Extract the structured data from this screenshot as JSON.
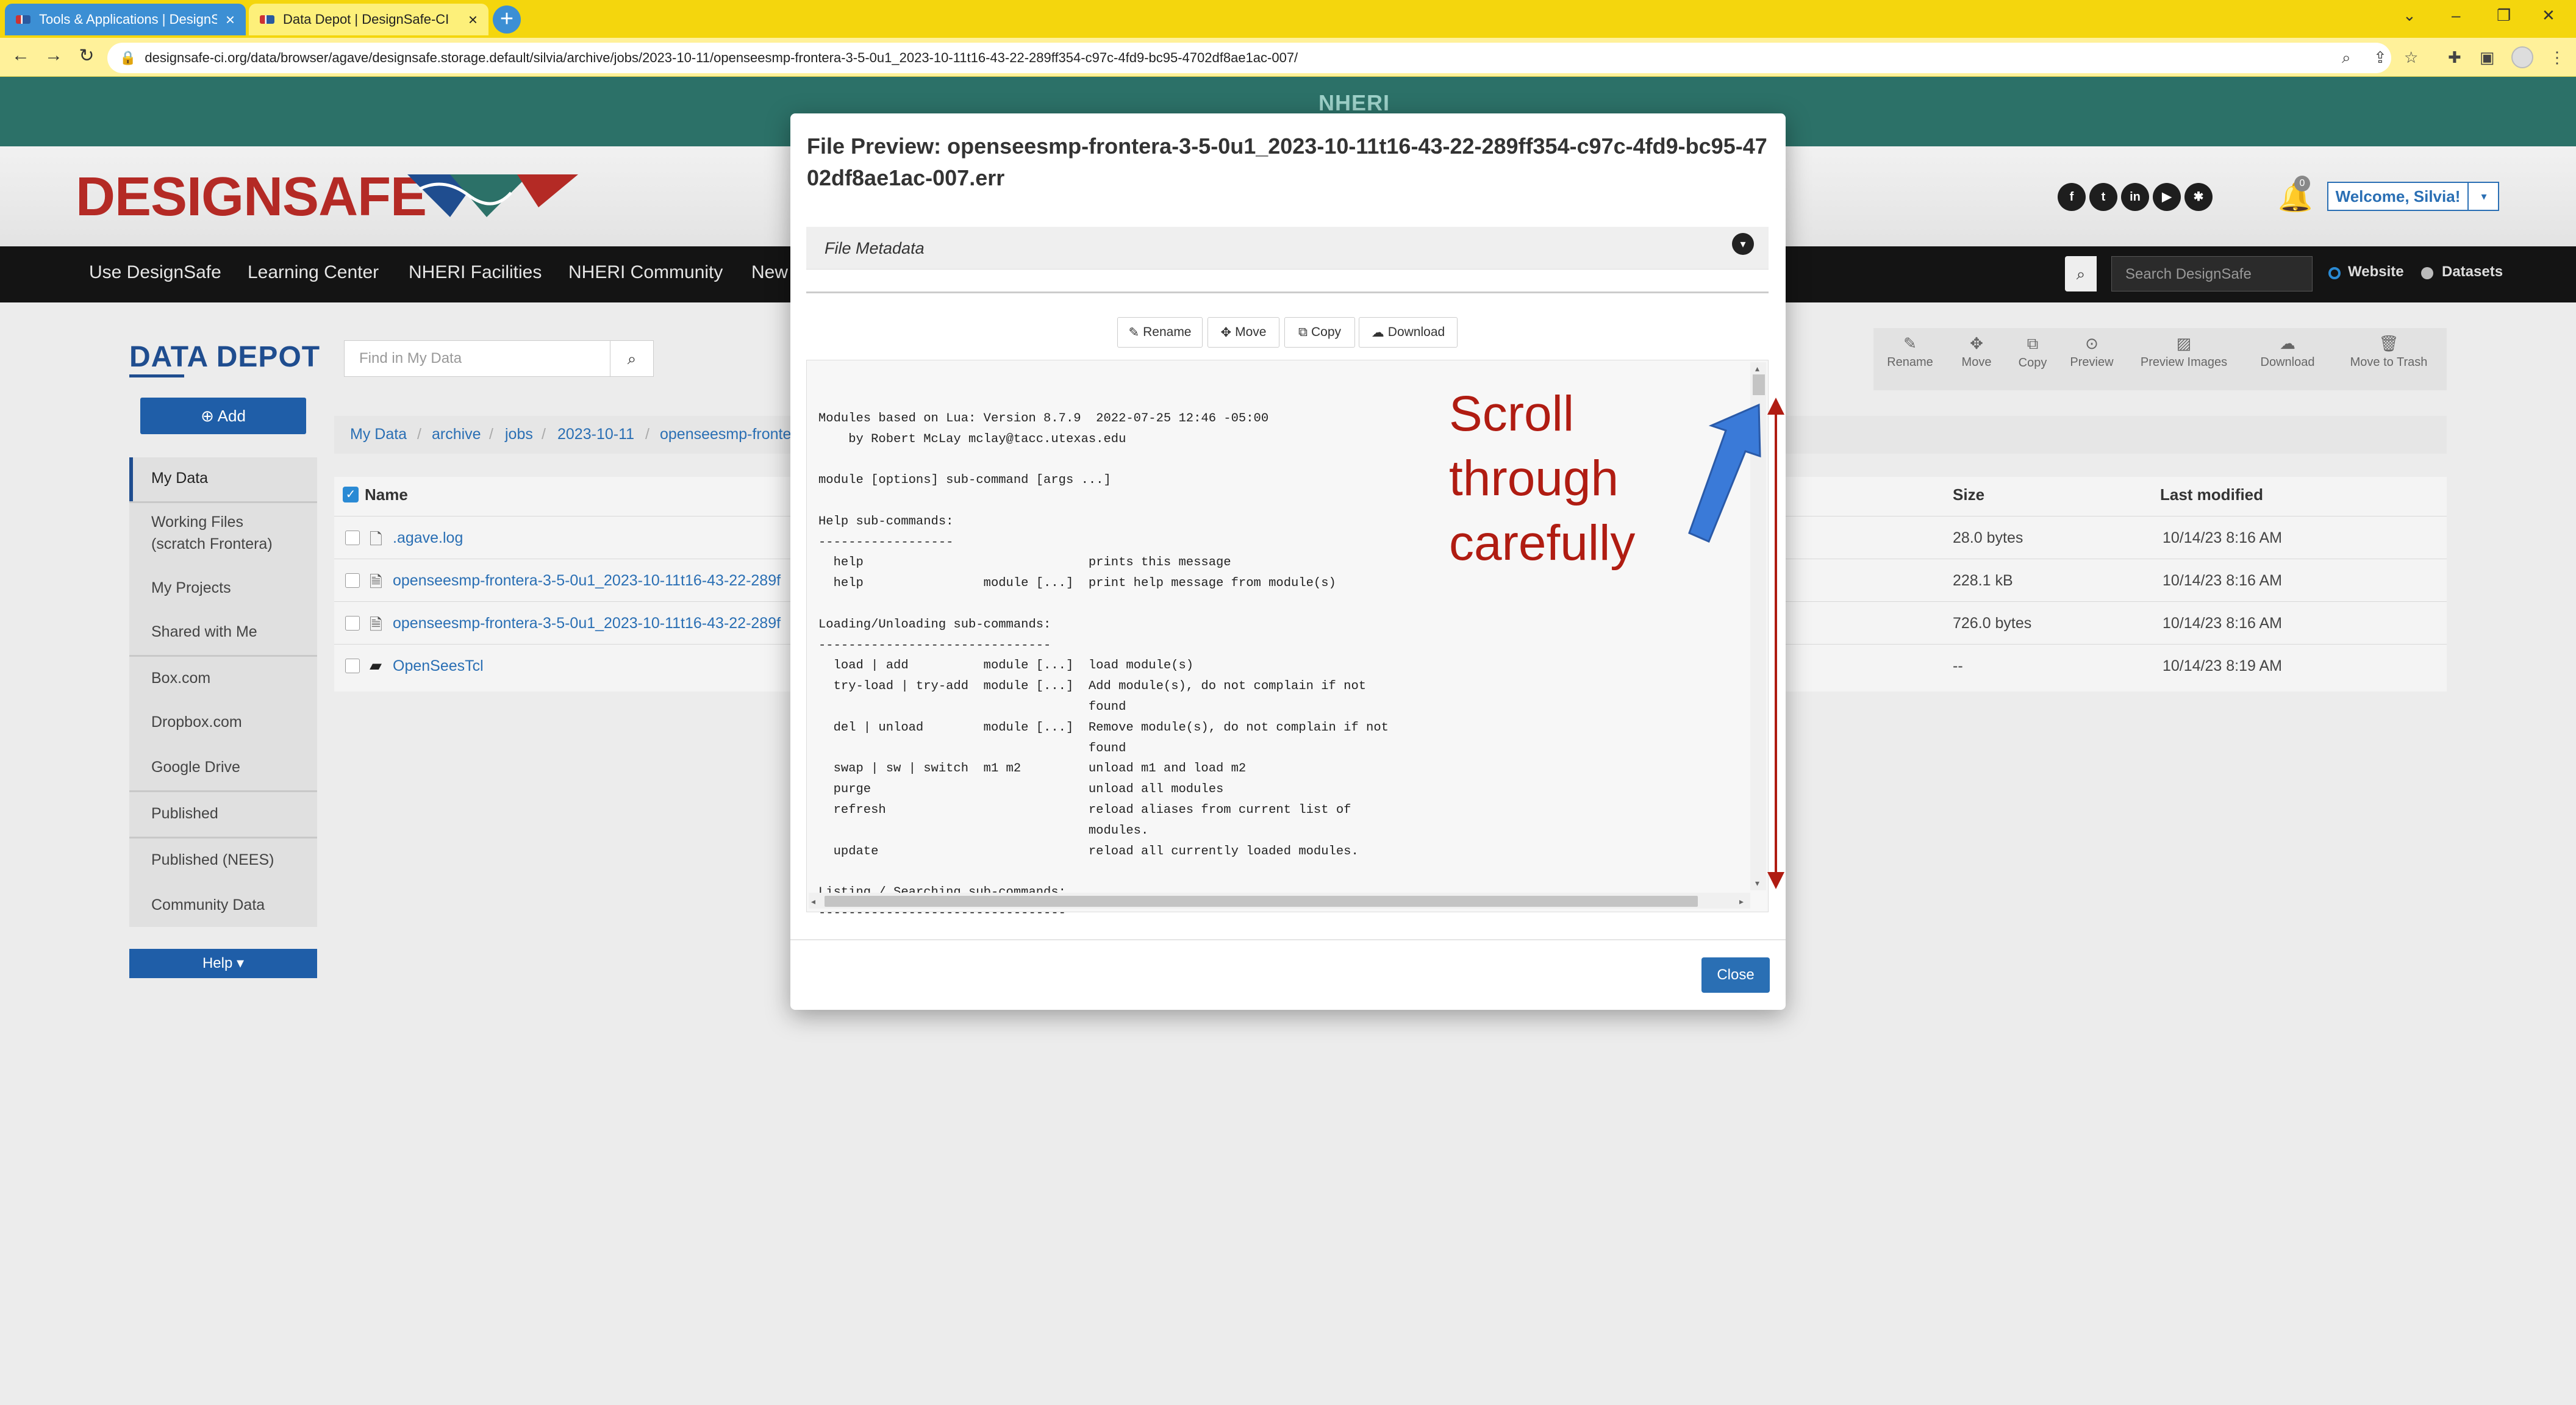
{
  "browser": {
    "tabs": [
      {
        "label": "Tools & Applications | DesignSaf",
        "close": "×"
      },
      {
        "label": "Data Depot | DesignSafe-CI",
        "close": "×"
      }
    ],
    "new_tab": "+",
    "url": "designsafe-ci.org/data/browser/agave/designsafe.storage.default/silvia/archive/jobs/2023-10-11/openseesmp-frontera-3-5-0u1_2023-10-11t16-43-22-289ff354-c97c-4fd9-bc95-4702df8ae1ac-007/",
    "window_controls": [
      "⌄",
      "–",
      "❐",
      "✕"
    ]
  },
  "site": {
    "banner": "NHERI",
    "logo": "DESIGNSAFE",
    "social": [
      "f",
      "t",
      "in",
      "▶",
      "✱"
    ],
    "notifications": "0",
    "welcome": "Welcome, Silvia!",
    "nav": [
      "Use DesignSafe",
      "Learning Center",
      "NHERI Facilities",
      "NHERI Community",
      "New"
    ],
    "search_placeholder": "Search DesignSafe",
    "search_scope": [
      "Website",
      "Datasets"
    ]
  },
  "depot": {
    "title": "DATA DEPOT",
    "add": "⊕ Add",
    "find_placeholder": "Find in My Data",
    "side": [
      "My Data",
      "Working Files",
      "(scratch Frontera)",
      "My Projects",
      "Shared with Me",
      "Box.com",
      "Dropbox.com",
      "Google Drive",
      "Published",
      "Published (NEES)",
      "Community Data"
    ],
    "help": "Help ▾",
    "toolbar": [
      "Rename",
      "Move",
      "Copy",
      "Preview",
      "Preview Images",
      "Download",
      "Move to Trash"
    ],
    "breadcrumb": [
      "My Data",
      "archive",
      "jobs",
      "2023-10-11",
      "openseesmp-fronte"
    ],
    "columns": {
      "name": "Name",
      "size": "Size",
      "modified": "Last modified"
    },
    "files": [
      {
        "name": ".agave.log",
        "size": "28.0 bytes",
        "modified": "10/14/23 8:16 AM"
      },
      {
        "name": "openseesmp-frontera-3-5-0u1_2023-10-11t16-43-22-289f",
        "size": "228.1 kB",
        "modified": "10/14/23 8:16 AM"
      },
      {
        "name": "openseesmp-frontera-3-5-0u1_2023-10-11t16-43-22-289f",
        "size": "726.0 bytes",
        "modified": "10/14/23 8:16 AM"
      },
      {
        "name": "OpenSeesTcl",
        "size": "--",
        "modified": "10/14/23 8:19 AM"
      }
    ]
  },
  "modal": {
    "title": "File Preview: openseesmp-frontera-3-5-0u1_2023-10-11t16-43-22-289ff354-c97c-4fd9-bc95-4702df8ae1ac-007.err",
    "metadata": "File Metadata",
    "buttons": [
      "Rename",
      "Move",
      "Copy",
      "Download"
    ],
    "close": "Close",
    "content": "\nModules based on Lua: Version 8.7.9  2022-07-25 12:46 -05:00\n    by Robert McLay mclay@tacc.utexas.edu\n\nmodule [options] sub-command [args ...]\n\nHelp sub-commands:\n------------------\n  help                              prints this message\n  help                module [...]  print help message from module(s)\n\nLoading/Unloading sub-commands:\n-------------------------------\n  load | add          module [...]  load module(s)\n  try-load | try-add  module [...]  Add module(s), do not complain if not\n                                    found\n  del | unload        module [...]  Remove module(s), do not complain if not\n                                    found\n  swap | sw | switch  m1 m2         unload m1 and load m2\n  purge                             unload all modules\n  refresh                           reload aliases from current list of\n                                    modules.\n  update                            reload all currently loaded modules.\n\nListing / Searching sub-commands:\n---------------------------------"
  },
  "annotation": {
    "line1": "Scroll",
    "line2": "through",
    "line3": "carefully"
  }
}
